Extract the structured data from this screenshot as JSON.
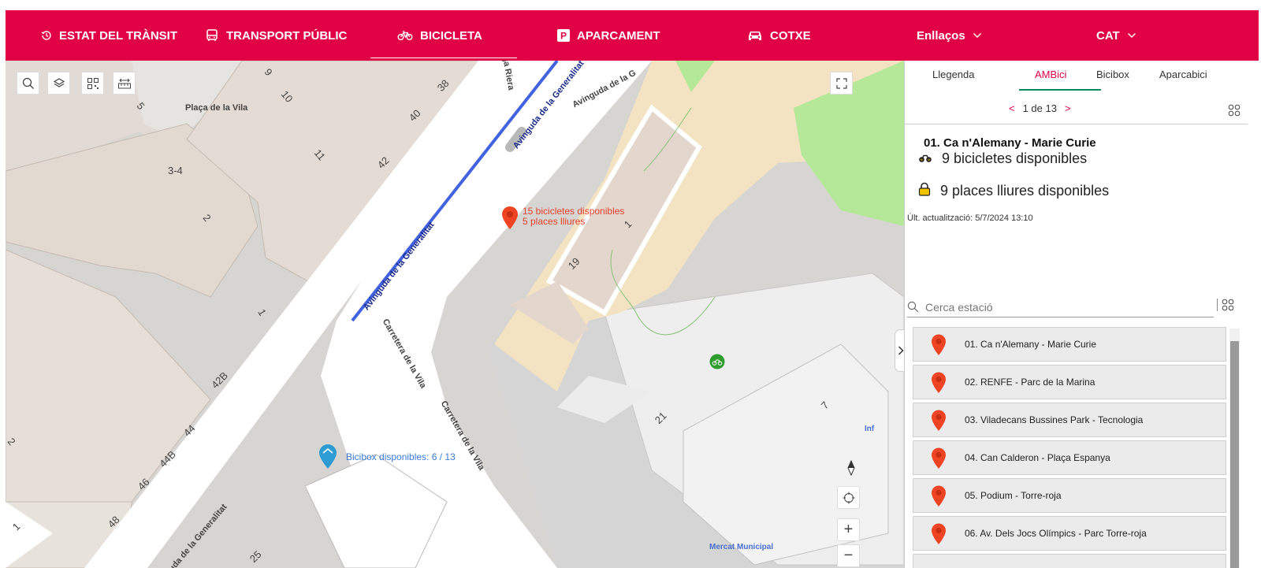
{
  "nav": {
    "traffic": "ESTAT DEL TRÀNSIT",
    "transport": "TRANSPORT PÚBLIC",
    "bike": "BICICLETA",
    "parking": "APARCAMENT",
    "car": "COTXE",
    "links": "Enllaços",
    "lang": "CAT"
  },
  "map": {
    "streets": {
      "placa_vila": "Plaça de la Vila",
      "riera": "ga Riera",
      "avinguda_top": "Avinguda de la G",
      "avinguda_generalitat": "Avinguda de la Generalitat",
      "avinguda_generalitat_2": "Avinguda de la Generalitat",
      "avinguda_left": "uda de la Generalitat",
      "carretera_vila": "Carretera de la Vila",
      "carretera_vila_2": "Carretera de la Vila",
      "mercat": "Mercat Municipal",
      "inf": "Inf"
    },
    "numbers": [
      "9",
      "10",
      "38",
      "40",
      "11",
      "42",
      "3-4",
      "2",
      "1",
      "42B",
      "44",
      "44B",
      "46",
      "48",
      "19",
      "1",
      "7",
      "21",
      "2",
      "1",
      "5",
      "25"
    ],
    "station_popup": {
      "bikes": "15 bicicletes disponibles",
      "places": "5 places lliures"
    },
    "bicibox": "Bicibox disponibles: 6 / 13",
    "zoom_in": "+",
    "zoom_out": "−"
  },
  "panel": {
    "tabs": [
      "Llegenda",
      "AMBici",
      "Bicibox",
      "Aparcabici"
    ],
    "active_tab": "AMBici",
    "pager": {
      "prev": "<",
      "text": "1 de 13",
      "next": ">"
    },
    "station": {
      "title": "01. Ca n'Alemany - Marie Curie",
      "bikes": "9  bicicletes disponibles",
      "places": "9 places lliures disponibles",
      "updated": "Últ. actualització: 5/7/2024 13:10"
    },
    "search_placeholder": "Cerca estació",
    "list": [
      "01. Ca n'Alemany - Marie Curie",
      "02. RENFE - Parc de la Marina",
      "03. Viladecans Bussines Park - Tecnologia",
      "04. Can Calderon - Plaça Espanya",
      "05. Podium - Torre-roja",
      "06. Av. Dels Jocs Olímpics - Parc Torre-roja",
      ""
    ]
  },
  "colors": {
    "brand": "#e10046",
    "pin": "#ef4423",
    "bicibox": "#2e9cd4",
    "bike_route": "#4263e0",
    "park": "#b6e89a",
    "sand": "#f4e3c2"
  }
}
